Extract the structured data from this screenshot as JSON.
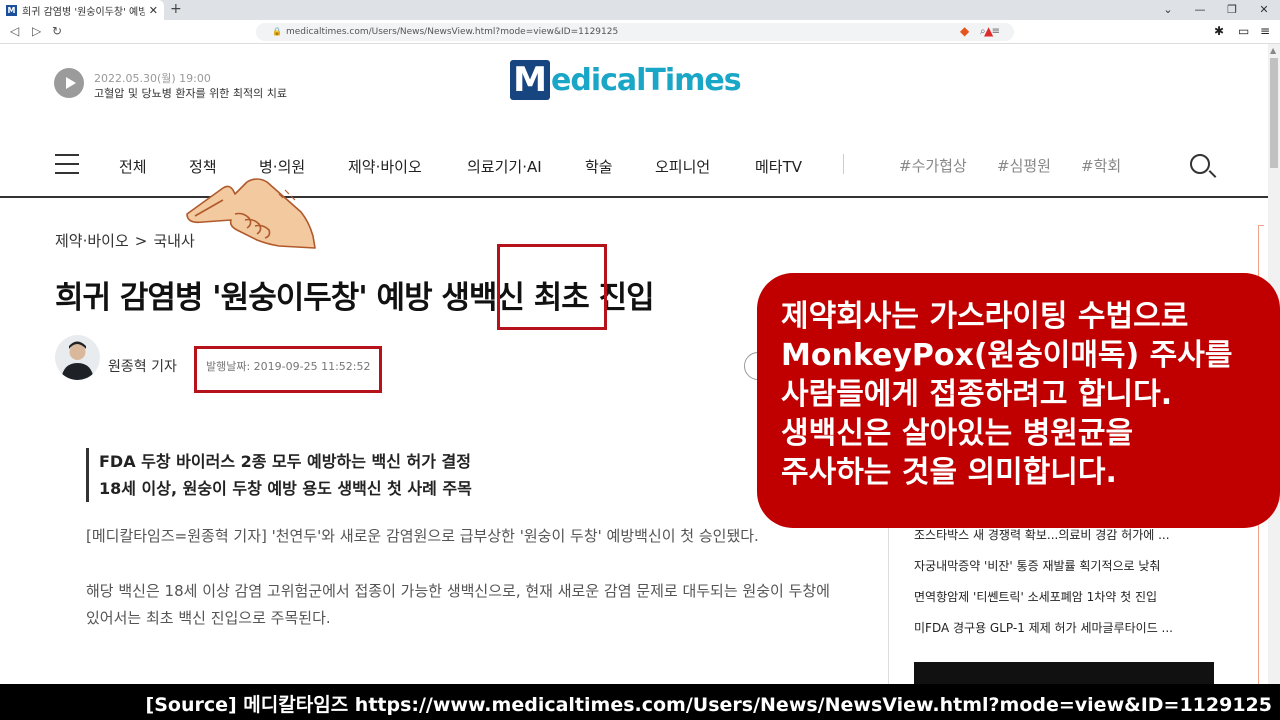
{
  "browser": {
    "tab_title": "희귀 감염병 '원숭이두창' 예방 생",
    "url": "medicaltimes.com/Users/News/NewsView.html?mode=view&ID=1129125"
  },
  "header": {
    "brief_date": "2022.05.30(월) 19:00",
    "brief_title": "고혈압 및 당뇨병 환자를 위한 최적의 치료",
    "logo_m": "M",
    "logo_word": "edicalTimes"
  },
  "nav": {
    "items": [
      "전체",
      "정책",
      "병·의원",
      "제약·바이오",
      "의료기기·AI",
      "학술",
      "오피니언",
      "메타TV"
    ],
    "tags": [
      "#수가협상",
      "#심평원",
      "#학회"
    ]
  },
  "article": {
    "crumb_section": "제약·바이오",
    "crumb_sep": ">",
    "crumb_sub": "국내사",
    "headline": "희귀 감염병 '원숭이두창' 예방 생백신 최초 진입",
    "reporter": "원종혁 기자",
    "pubdate": "발행날짜: 2019-09-25 11:52:52",
    "summary_1": "FDA 두창 바이러스 2종 모두 예방하는 백신 허가 결정",
    "summary_2": "18세 이상, 원숭이 두창 예방 용도 생백신 첫 사례 주목",
    "para_1": "[메디칼타임즈=원종혁 기자] '천연두'와 새로운 감염원으로 급부상한 '원숭이 두창' 예방백신이 첫 승인됐다.",
    "para_2": "해당 백신은 18세 이상 감염 고위험군에서 접종이 가능한 생백신으로, 현재 새로운 감염 문제로 대두되는 원숭이 두창에 있어서는 최초 백신 진입으로 주목된다."
  },
  "sidebar": {
    "items": [
      "조스타박스 새 경쟁력 확보...의료비 경감 허가에 ...",
      "자궁내막증약 '비잔' 통증 재발률 획기적으로 낮춰",
      "면역항암제 '티쎈트릭' 소세포폐암 1차약 첫 진입",
      "미FDA 경구용 GLP-1 제제 허가 세마글루타이드 ..."
    ]
  },
  "callout": {
    "lines": [
      "제약회사는 가스라이팅 수법으로",
      "MonkeyPox(원숭이매독) 주사를",
      "사람들에게 접종하려고 합니다.",
      "생백신은 살아있는 병원균을",
      "주사하는 것을 의미합니다."
    ]
  },
  "footer": {
    "source": "[Source] 메디칼타임즈   https://www.medicaltimes.com/Users/News/NewsView.html?mode=view&ID=1129125"
  },
  "colors": {
    "accent_red": "#c00000",
    "logo_navy": "#16457f",
    "logo_cyan": "#1aa6c7"
  }
}
